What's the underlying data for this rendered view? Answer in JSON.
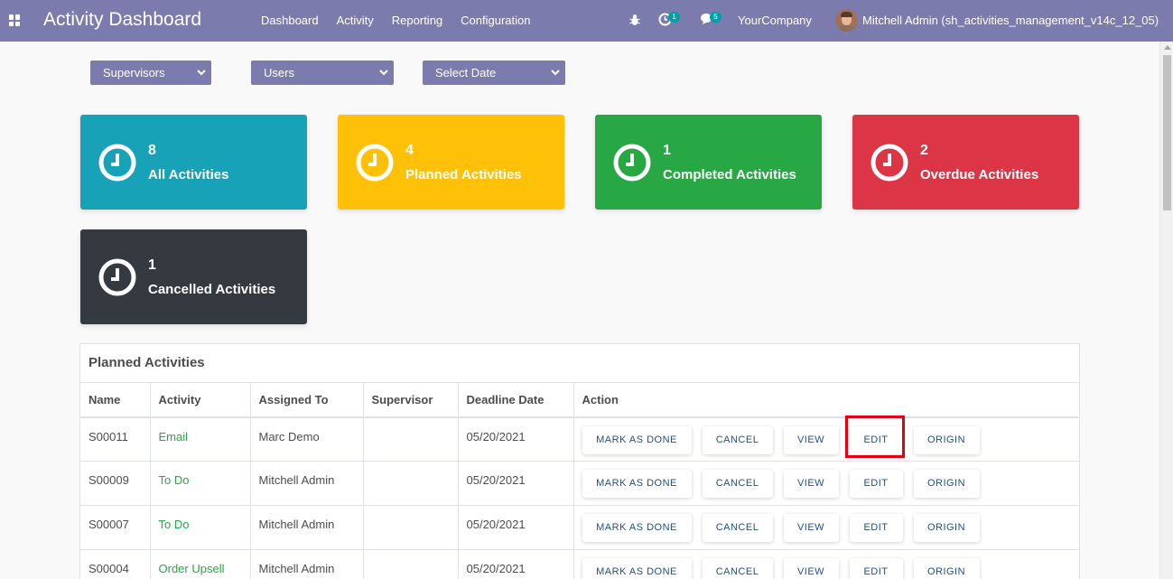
{
  "navbar": {
    "app_title": "Activity Dashboard",
    "menu": [
      "Dashboard",
      "Activity",
      "Reporting",
      "Configuration"
    ],
    "activity_badge": "1",
    "message_badge": "5",
    "company": "YourCompany",
    "user": "Mitchell Admin (sh_activities_management_v14c_12_05)",
    "bg_color": "#7c7bad"
  },
  "filters": {
    "supervisors": "Supervisors",
    "users": "Users",
    "date": "Select Date"
  },
  "tiles": [
    {
      "count": "8",
      "label": "All Activities",
      "color": "#17a2b8"
    },
    {
      "count": "4",
      "label": "Planned Activities",
      "color": "#ffc107"
    },
    {
      "count": "1",
      "label": "Completed Activities",
      "color": "#28a745"
    },
    {
      "count": "2",
      "label": "Overdue Activities",
      "color": "#dc3545"
    },
    {
      "count": "1",
      "label": "Cancelled Activities",
      "color": "#343a40"
    }
  ],
  "table": {
    "title": "Planned Activities",
    "headers": [
      "Name",
      "Activity",
      "Assigned To",
      "Supervisor",
      "Deadline Date",
      "Action"
    ],
    "rows": [
      {
        "name": "S00011",
        "activity": "Email",
        "assigned": "Marc Demo",
        "supervisor": "",
        "deadline": "05/20/2021"
      },
      {
        "name": "S00009",
        "activity": "To Do",
        "assigned": "Mitchell Admin",
        "supervisor": "",
        "deadline": "05/20/2021"
      },
      {
        "name": "S00007",
        "activity": "To Do",
        "assigned": "Mitchell Admin",
        "supervisor": "",
        "deadline": "05/20/2021"
      },
      {
        "name": "S00004",
        "activity": "Order Upsell",
        "assigned": "Mitchell Admin",
        "supervisor": "",
        "deadline": "05/20/2021"
      }
    ],
    "buttons": {
      "done": "MARK AS DONE",
      "cancel": "CANCEL",
      "view": "VIEW",
      "edit": "EDIT",
      "origin": "ORIGIN"
    }
  }
}
